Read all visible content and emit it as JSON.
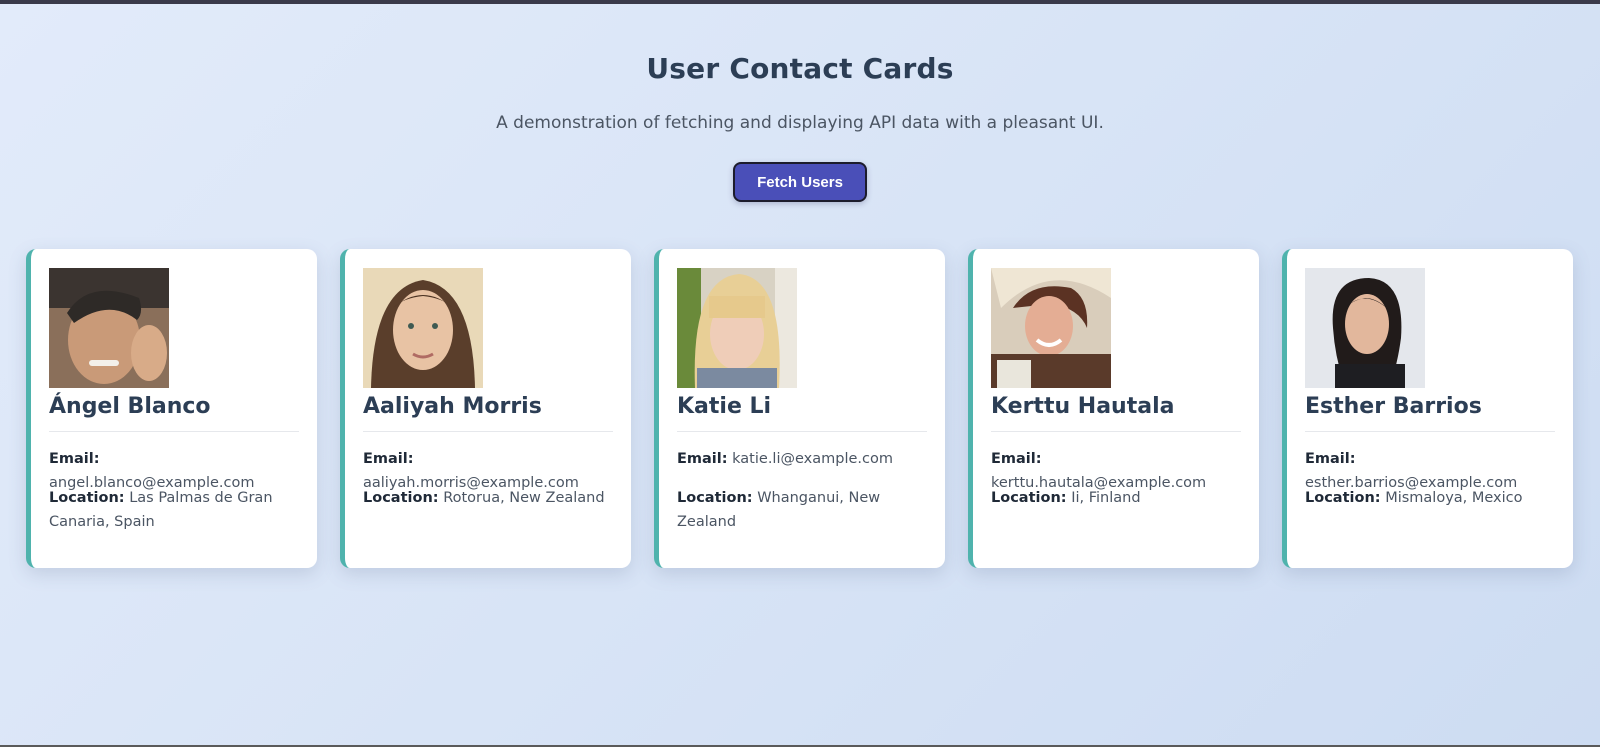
{
  "header": {
    "title": "User Contact Cards",
    "subtitle": "A demonstration of fetching and displaying API data with a pleasant UI.",
    "fetch_button_label": "Fetch Users"
  },
  "labels": {
    "email": "Email:",
    "location": "Location:"
  },
  "colors": {
    "accent": "#4fb3ad",
    "button": "#4a4fb8",
    "title": "#2c3e55"
  },
  "users": [
    {
      "name": "Ángel Blanco",
      "email": "angel.blanco@example.com",
      "location": "Las Palmas de Gran Canaria, Spain"
    },
    {
      "name": "Aaliyah Morris",
      "email": "aaliyah.morris@example.com",
      "location": "Rotorua, New Zealand"
    },
    {
      "name": "Katie Li",
      "email": "katie.li@example.com",
      "location": "Whanganui, New Zealand"
    },
    {
      "name": "Kerttu Hautala",
      "email": "kerttu.hautala@example.com",
      "location": "Ii, Finland"
    },
    {
      "name": "Esther Barrios",
      "email": "esther.barrios@example.com",
      "location": "Mismaloya, Mexico"
    }
  ]
}
